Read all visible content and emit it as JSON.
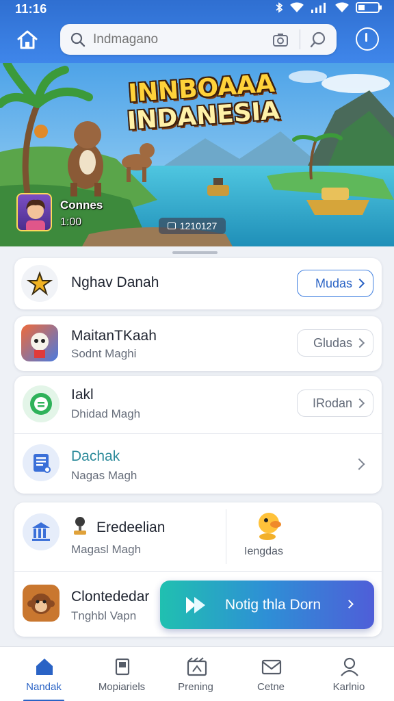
{
  "status_bar": {
    "time": "11:16"
  },
  "search": {
    "placeholder": "Indmagano"
  },
  "banner": {
    "title_line1": "INNBOAAA",
    "title_line2": "INDANESIA",
    "player_name": "Connes",
    "player_time": "1:00",
    "counter": "1210127"
  },
  "list": {
    "row1": {
      "title": "Nghav Danah",
      "button": "Mudas"
    },
    "row2": {
      "title": "MaitanTKaah",
      "subtitle": "Sodnt Maghi",
      "button": "Gludas"
    },
    "row3": {
      "title": "Iakl",
      "subtitle": "Dhidad Magh",
      "button": "IRodan"
    },
    "row4": {
      "title": "Dachak",
      "subtitle": "Nagas Magh"
    },
    "row5": {
      "title": "Eredeelian",
      "subtitle": "Magasl Magh",
      "side_label": "Iengdas"
    },
    "row6": {
      "title": "Clontededar",
      "subtitle": "Tnghbl Vapn"
    }
  },
  "cta": {
    "label": "Notig thla Dorn"
  },
  "bottom_nav": [
    {
      "label": "Nandak"
    },
    {
      "label": "Mopiariels"
    },
    {
      "label": "Prening"
    },
    {
      "label": "Cetne"
    },
    {
      "label": "Karlnio"
    }
  ],
  "colors": {
    "header_blue": "#3f86ea",
    "accent": "#2a63c5",
    "cta_start": "#20c0b0",
    "cta_end": "#4f5ed8"
  }
}
